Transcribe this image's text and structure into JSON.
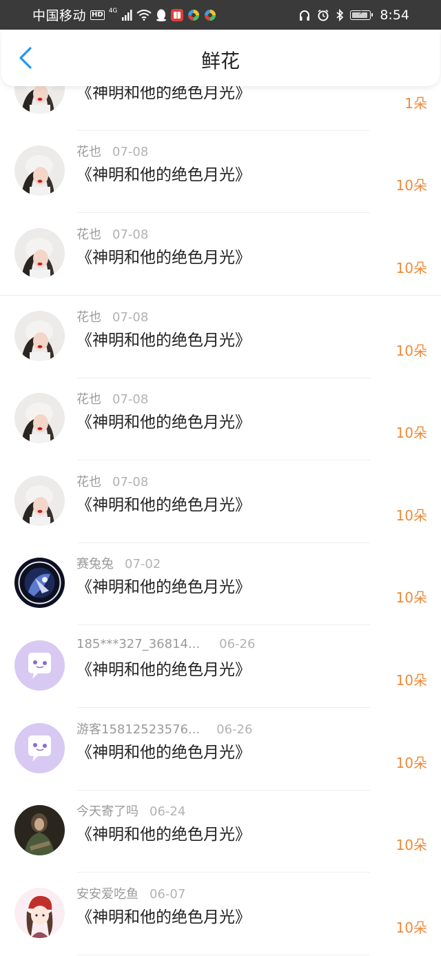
{
  "status_bar": {
    "carrier": "中国移动",
    "hd": "HD",
    "network": "4G",
    "time": "8:54"
  },
  "header": {
    "title": "鲜花",
    "back_icon": "chevron-left-icon",
    "accent": "#2196F3"
  },
  "colors": {
    "amount": "#EE8A3A",
    "meta": "#9A9A9A",
    "title": "#222222"
  },
  "list": [
    {
      "name": "",
      "date": "",
      "title": "《神明和他的绝色月光》",
      "amount": "1朵",
      "avatar": "girl-photo"
    },
    {
      "name": "花也",
      "date": "07-08",
      "title": "《神明和他的绝色月光》",
      "amount": "10朵",
      "avatar": "girl-photo"
    },
    {
      "name": "花也",
      "date": "07-08",
      "title": "《神明和他的绝色月光》",
      "amount": "10朵",
      "avatar": "girl-photo"
    },
    {
      "name": "花也",
      "date": "07-08",
      "title": "《神明和他的绝色月光》",
      "amount": "10朵",
      "avatar": "girl-photo"
    },
    {
      "name": "花也",
      "date": "07-08",
      "title": "《神明和他的绝色月光》",
      "amount": "10朵",
      "avatar": "girl-photo"
    },
    {
      "name": "花也",
      "date": "07-08",
      "title": "《神明和他的绝色月光》",
      "amount": "10朵",
      "avatar": "girl-photo"
    },
    {
      "name": "赛兔兔",
      "date": "07-02",
      "title": "《神明和他的绝色月光》",
      "amount": "10朵",
      "avatar": "anime-dark"
    },
    {
      "name": "185***327_36814...",
      "date": "06-26",
      "title": "《神明和他的绝色月光》",
      "amount": "10朵",
      "avatar": "chat-bubble"
    },
    {
      "name": "游客15812523576...",
      "date": "06-26",
      "title": "《神明和他的绝色月光》",
      "amount": "10朵",
      "avatar": "chat-bubble"
    },
    {
      "name": "今天寄了吗",
      "date": "06-24",
      "title": "《神明和他的绝色月光》",
      "amount": "10朵",
      "avatar": "dark-figure"
    },
    {
      "name": "安安爱吃鱼",
      "date": "06-07",
      "title": "《神明和他的绝色月光》",
      "amount": "10朵",
      "avatar": "cartoon-girl"
    }
  ]
}
